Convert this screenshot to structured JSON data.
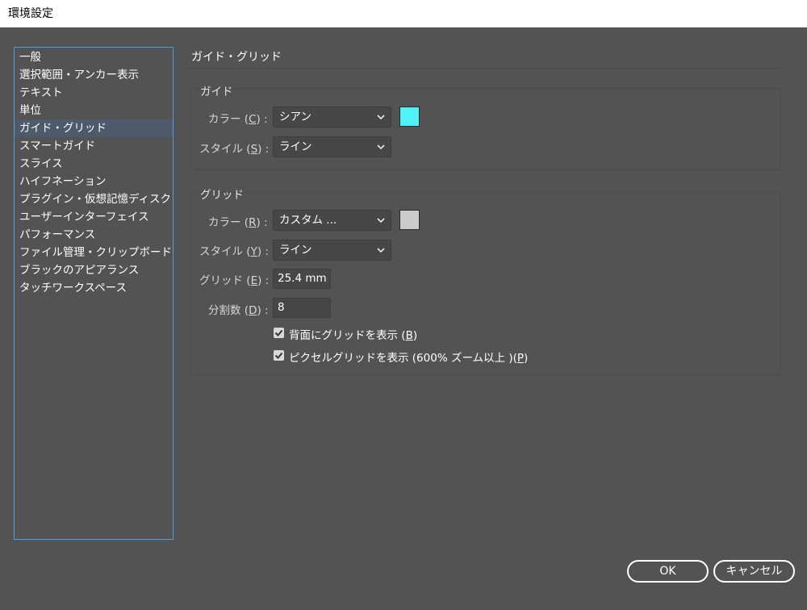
{
  "window": {
    "title": "環境設定"
  },
  "sidebar": {
    "items": [
      {
        "label": "一般"
      },
      {
        "label": "選択範囲・アンカー表示"
      },
      {
        "label": "テキスト"
      },
      {
        "label": "単位"
      },
      {
        "label": "ガイド・グリッド",
        "selected": true
      },
      {
        "label": "スマートガイド"
      },
      {
        "label": "スライス"
      },
      {
        "label": "ハイフネーション"
      },
      {
        "label": "プラグイン・仮想記憶ディスク"
      },
      {
        "label": "ユーザーインターフェイス"
      },
      {
        "label": "パフォーマンス"
      },
      {
        "label": "ファイル管理・クリップボード"
      },
      {
        "label": "ブラックのアピアランス"
      },
      {
        "label": "タッチワークスペース"
      }
    ]
  },
  "section": {
    "title": "ガイド・グリッド"
  },
  "guides": {
    "title": "ガイド",
    "color": {
      "label_pre": "カラー (",
      "label_key": "C",
      "label_post": ") :",
      "value": "シアン",
      "swatch": "#4ff3f7"
    },
    "style": {
      "label_pre": "スタイル (",
      "label_key": "S",
      "label_post": ") :",
      "value": "ライン"
    }
  },
  "grid": {
    "title": "グリッド",
    "color": {
      "label_pre": "カラー (",
      "label_key": "R",
      "label_post": ") :",
      "value": "カスタム ...",
      "swatch": "#cbcbcb"
    },
    "style": {
      "label_pre": "スタイル (",
      "label_key": "Y",
      "label_post": ") :",
      "value": "ライン"
    },
    "gridline": {
      "label_pre": "グリッド (",
      "label_key": "E",
      "label_post": ") :",
      "value": "25.4 mm"
    },
    "subdivisions": {
      "label_pre": "分割数 (",
      "label_key": "D",
      "label_post": ") :",
      "value": "8"
    },
    "grids_in_back": {
      "label_pre": "背面にグリッドを表示 (",
      "label_key": "B",
      "label_post": ")",
      "checked": true
    },
    "pixel_grid": {
      "label_pre": "ピクセルグリッドを表示 (600% ズーム以上 )(",
      "label_key": "P",
      "label_post": ")",
      "checked": true
    }
  },
  "buttons": {
    "ok": "OK",
    "cancel": "キャンセル"
  },
  "colors": {
    "accent_border": "#4a9fe0",
    "background": "#535353",
    "selected_item": "#4c5a6b"
  }
}
